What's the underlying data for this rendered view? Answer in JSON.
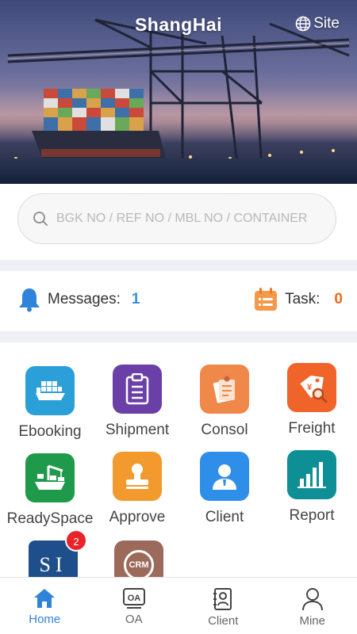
{
  "header": {
    "city": "ShangHai",
    "site_label": "Site",
    "site_icon": "globe-icon"
  },
  "search": {
    "placeholder": "BGK NO / REF NO / MBL NO / CONTAINER",
    "icon": "search-icon"
  },
  "status": {
    "messages_label": "Messages:",
    "messages_count": "1",
    "messages_color": "#3a8fe0",
    "task_label": "Task:",
    "task_count": "0",
    "task_color": "#ee6a1c"
  },
  "apps": [
    {
      "label": "Ebooking",
      "icon": "ship-icon",
      "color": "#2a9fd8"
    },
    {
      "label": "Shipment",
      "icon": "clipboard-icon",
      "color": "#6a3fa8"
    },
    {
      "label": "Consol",
      "icon": "consol-icon",
      "color": "#f0884a"
    },
    {
      "label": "Freight",
      "icon": "price-tag-icon",
      "color": "#f0642a"
    },
    {
      "label": "ReadySpace",
      "icon": "crane-ship-icon",
      "color": "#1e9a4a"
    },
    {
      "label": "Approve",
      "icon": "stamp-icon",
      "color": "#f29a2e"
    },
    {
      "label": "Client",
      "icon": "person-icon",
      "color": "#2f8fe8"
    },
    {
      "label": "Report",
      "icon": "bar-chart-icon",
      "color": "#0e8f96"
    },
    {
      "label": "SI",
      "icon": "si-icon",
      "color": "#1e4f8a",
      "badge": "2",
      "tile_text": "SI"
    },
    {
      "label": "CRM",
      "icon": "crm-icon",
      "color": "#9c6a5a",
      "tile_text": "CRM"
    }
  ],
  "tabs": [
    {
      "label": "Home",
      "icon": "home-icon",
      "active": true
    },
    {
      "label": "OA",
      "icon": "oa-icon",
      "tile_text": "OA"
    },
    {
      "label": "Client",
      "icon": "contacts-icon"
    },
    {
      "label": "Mine",
      "icon": "user-icon"
    }
  ],
  "accent_color": "#2f83d8"
}
